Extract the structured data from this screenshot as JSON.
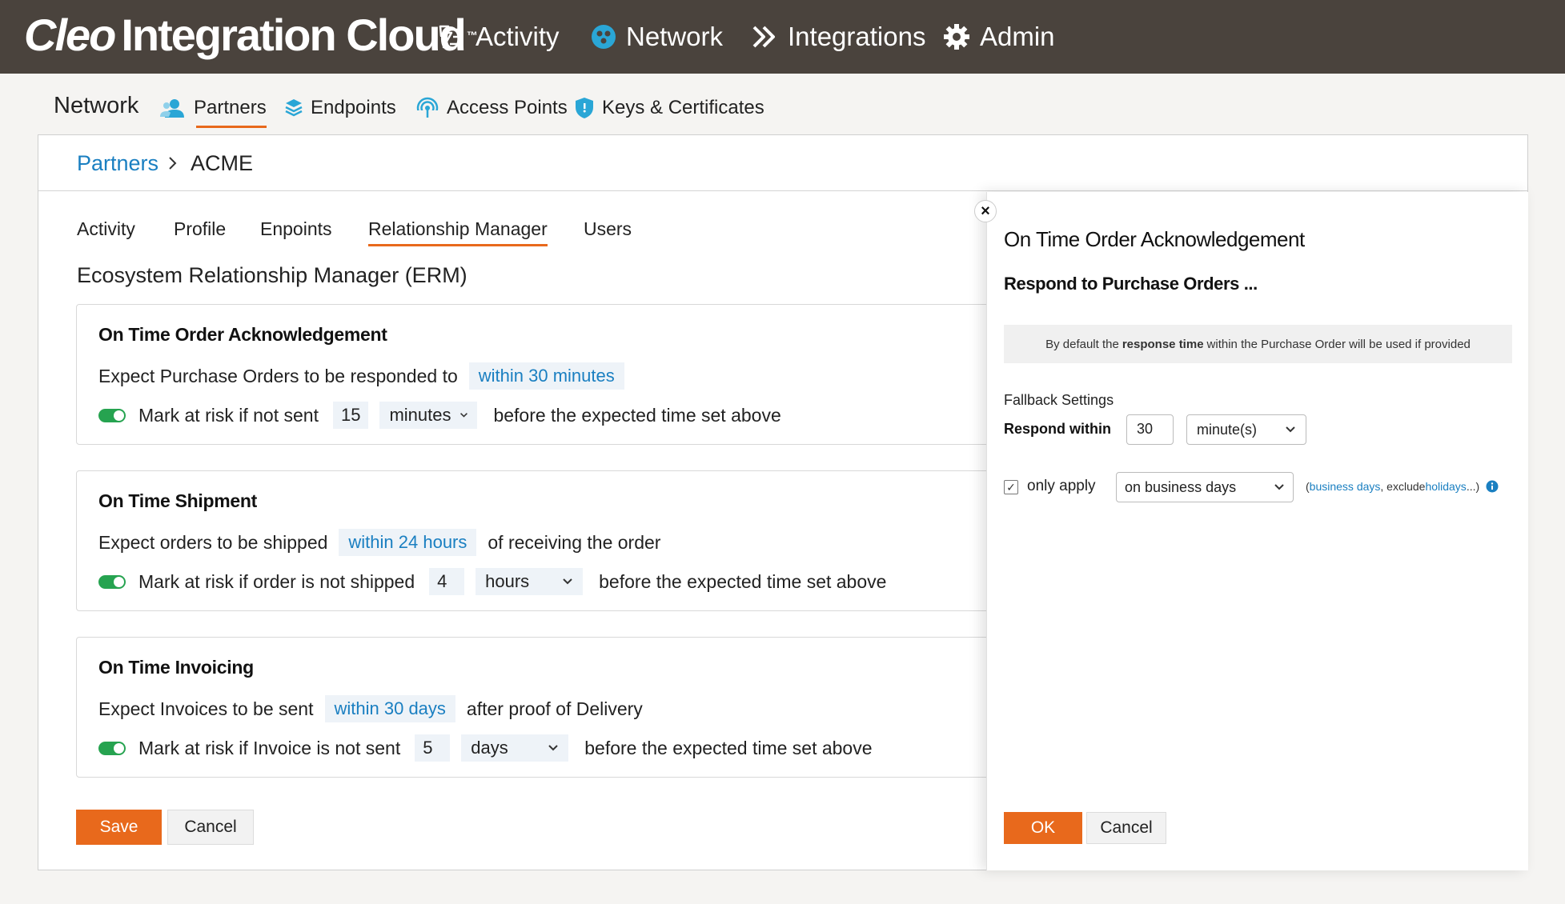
{
  "brand": {
    "logo_cleo": "Cleo",
    "logo_rest": "Integration Cloud",
    "logo_mark": "™"
  },
  "topnav": {
    "activity": "Activity",
    "network": "Network",
    "integrations": "Integrations",
    "admin": "Admin"
  },
  "subnav": {
    "title": "Network",
    "partners": "Partners",
    "endpoints": "Endpoints",
    "access_points": "Access Points",
    "keys": "Keys & Certificates"
  },
  "breadcrumb": {
    "parent": "Partners",
    "current": "ACME"
  },
  "tabs": {
    "activity": "Activity",
    "profile": "Profile",
    "endpoints": "Enpoints",
    "relationship": "Relationship Manager",
    "users": "Users"
  },
  "erm_title": "Ecosystem Relationship Manager (ERM)",
  "cards": {
    "ack": {
      "title": "On Time Order Acknowledgement",
      "expect": "Expect Purchase Orders to be responded to",
      "window": "within 30 minutes",
      "risk": "Mark at risk if not sent",
      "num": "15",
      "unit": "minutes",
      "tail": "before the expected time set above"
    },
    "ship": {
      "title": "On Time Shipment",
      "expect": "Expect orders to be shipped",
      "window": "within 24 hours",
      "after": "of receiving the order",
      "risk": "Mark at risk if order is not shipped",
      "num": "4",
      "unit": "hours",
      "tail": "before the expected time set above"
    },
    "invoice": {
      "title": "On Time Invoicing",
      "expect": "Expect Invoices to be sent",
      "window": "within 30 days",
      "after": "after proof of Delivery",
      "risk": "Mark at risk if Invoice is not sent",
      "num": "5",
      "unit": "days",
      "tail": "before the expected time set above"
    }
  },
  "buttons": {
    "save": "Save",
    "cancel": "Cancel"
  },
  "sheet": {
    "close": "×",
    "title": "On Time Order Acknowledgement",
    "subtitle": "Respond to Purchase Orders ...",
    "note_pre": "By default the",
    "note_bold": "response time",
    "note_post": "within the Purchase Order will be used if provided",
    "fallback": "Fallback Settings",
    "respond_label": "Respond within",
    "respond_value": "30",
    "respond_unit": "minute(s)",
    "checked": "✓",
    "only_apply": "only apply",
    "business_select": "on business days",
    "hint_open": "(",
    "hint_link1": "business days",
    "hint_mid": ", exclude ",
    "hint_link2": "holidays",
    "hint_close": " ...)",
    "ok": "OK",
    "cancel": "Cancel"
  },
  "colors": {
    "topbar": "#4a433d",
    "accent": "#e8691c",
    "link": "#1a7fc1",
    "toggle_on": "#26a350"
  }
}
